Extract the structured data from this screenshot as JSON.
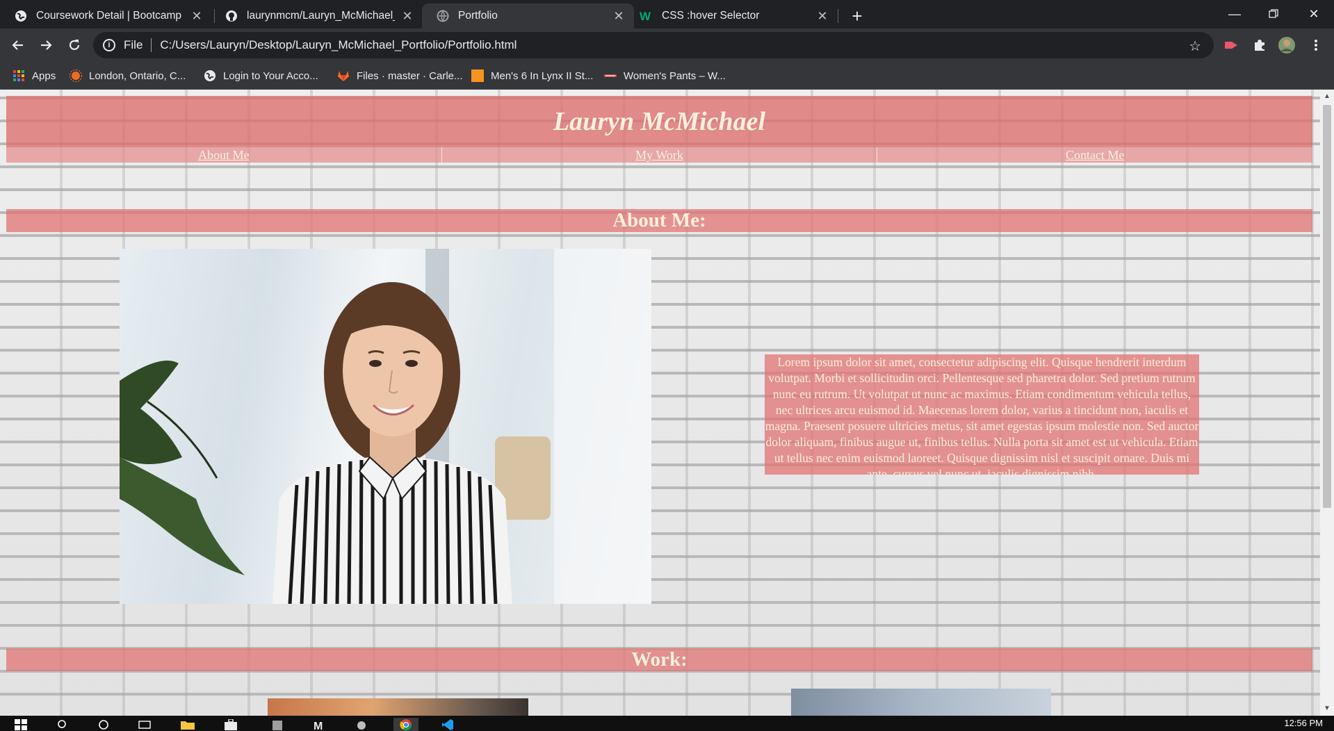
{
  "browser": {
    "tabs": [
      {
        "title": "Coursework Detail | Bootcamp Sp",
        "icon": "globe-icon",
        "active": false
      },
      {
        "title": "laurynmcm/Lauryn_McMichael_P",
        "icon": "github-icon",
        "active": false
      },
      {
        "title": "Portfolio",
        "icon": "globe-icon",
        "active": true
      },
      {
        "title": "CSS :hover Selector",
        "icon": "w3schools-icon",
        "active": false
      }
    ],
    "new_tab_label": "+",
    "address": {
      "scheme_label": "File",
      "url": "C:/Users/Lauryn/Desktop/Lauryn_McMichael_Portfolio/Portfolio.html"
    },
    "bookmarks": [
      {
        "label": "Apps",
        "icon": "apps-grid-icon"
      },
      {
        "label": "London, Ontario, C...",
        "icon": "weather-icon"
      },
      {
        "label": "Login to Your Acco...",
        "icon": "globe-icon"
      },
      {
        "label": "Files · master · Carle...",
        "icon": "gitlab-icon"
      },
      {
        "label": "Men's 6 In Lynx II St...",
        "icon": "orange-square-icon"
      },
      {
        "label": "Women's Pants – W...",
        "icon": "store-icon"
      }
    ]
  },
  "page": {
    "site_title": "Lauryn McMichael",
    "nav": [
      {
        "label": "About Me"
      },
      {
        "label": "My Work"
      },
      {
        "label": "Contact Me"
      }
    ],
    "about": {
      "heading": "About Me:",
      "body": "Lorem ipsum dolor sit amet, consectetur adipiscing elit. Quisque hendrerit interdum volutpat. Morbi et sollicitudin orci. Pellentesque sed pharetra dolor. Sed pretium rutrum nunc eu rutrum. Ut volutpat ut nunc ac maximus. Etiam condimentum vehicula tellus, nec ultrices arcu euismod id. Maecenas lorem dolor, varius a tincidunt non, iaculis et magna. Praesent posuere ultricies metus, sit amet egestas ipsum molestie non. Sed auctor dolor aliquam, finibus augue ut, finibus tellus. Nulla porta sit amet est ut vehicula. Etiam ut tellus nec enim euismod laoreet. Quisque dignissim nisl et suscipit ornare. Duis mi ante, cursus vel nunc ut, iaculis dignissim nibh."
    },
    "work": {
      "heading": "Work:"
    },
    "colors": {
      "accent": "#dc6e6e",
      "text_on_accent": "#f9f0dc"
    }
  },
  "taskbar": {
    "clock": "12:56 PM"
  }
}
